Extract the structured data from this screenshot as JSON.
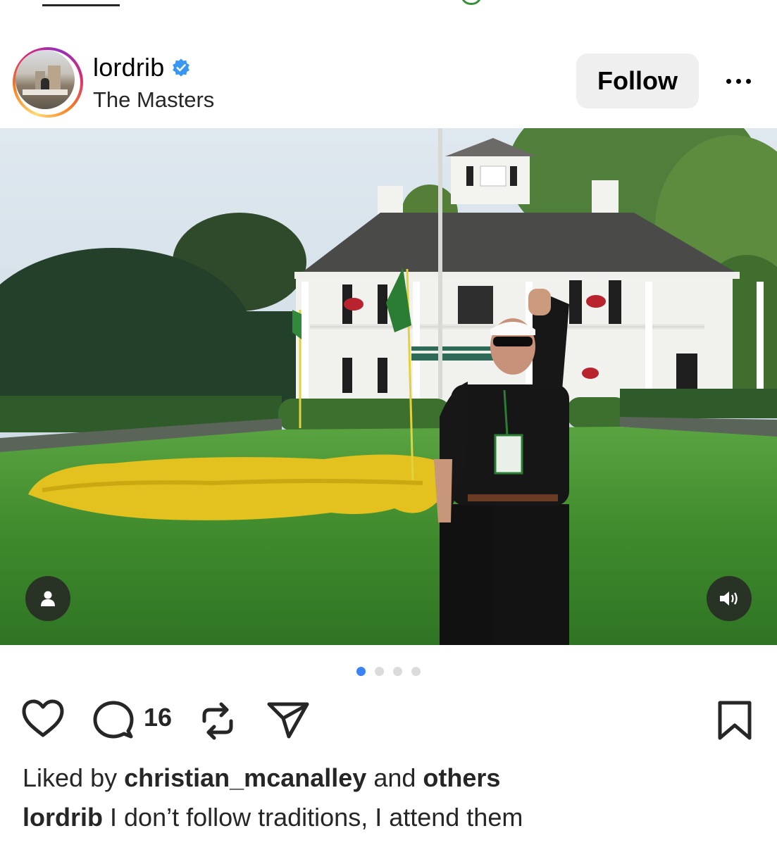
{
  "post": {
    "username": "lordrib",
    "location": "The Masters",
    "verified": true,
    "follow_label": "Follow",
    "comment_count": "16",
    "carousel": {
      "total": 4,
      "active_index": 0
    },
    "liked_prefix": "Liked by",
    "liked_user": "christian_mcanalley",
    "liked_and": "and",
    "liked_others": "others",
    "caption_user": "lordrib",
    "caption_text": "I don’t follow traditions, I attend them"
  },
  "icons": {
    "verified": "verified-badge-icon",
    "more": "more-options-icon",
    "tag": "user-tag-icon",
    "audio": "speaker-icon",
    "like": "heart-icon",
    "comment": "comment-icon",
    "repost": "repost-icon",
    "share": "send-icon",
    "save": "bookmark-icon"
  },
  "colors": {
    "verified_blue": "#3897f0",
    "active_dot": "#3b82f6",
    "follow_bg": "#efefef"
  }
}
